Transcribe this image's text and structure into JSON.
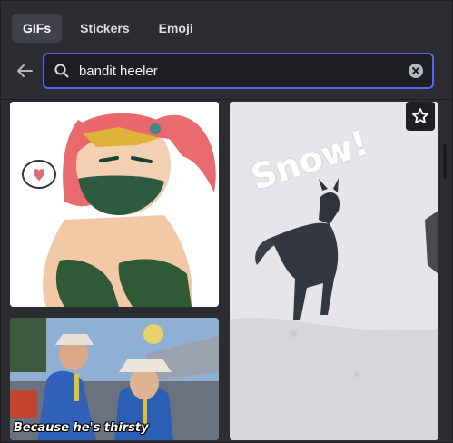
{
  "tabs": [
    {
      "label": "GIFs",
      "active": true
    },
    {
      "label": "Stickers",
      "active": false
    },
    {
      "label": "Emoji",
      "active": false
    }
  ],
  "search": {
    "value": "bandit heeler",
    "placeholder": "Search Tenor"
  },
  "results": [
    {
      "caption": ""
    },
    {
      "caption": "Because he's thirsty"
    },
    {
      "caption": "Snow!"
    }
  ],
  "colors": {
    "accent": "#5865f2",
    "panel": "#2b2d31",
    "input": "#1e1f22",
    "active_tab": "#404249"
  },
  "icons": {
    "back": "arrow-left-icon",
    "search": "search-icon",
    "clear": "clear-icon",
    "favorite": "star-icon"
  }
}
